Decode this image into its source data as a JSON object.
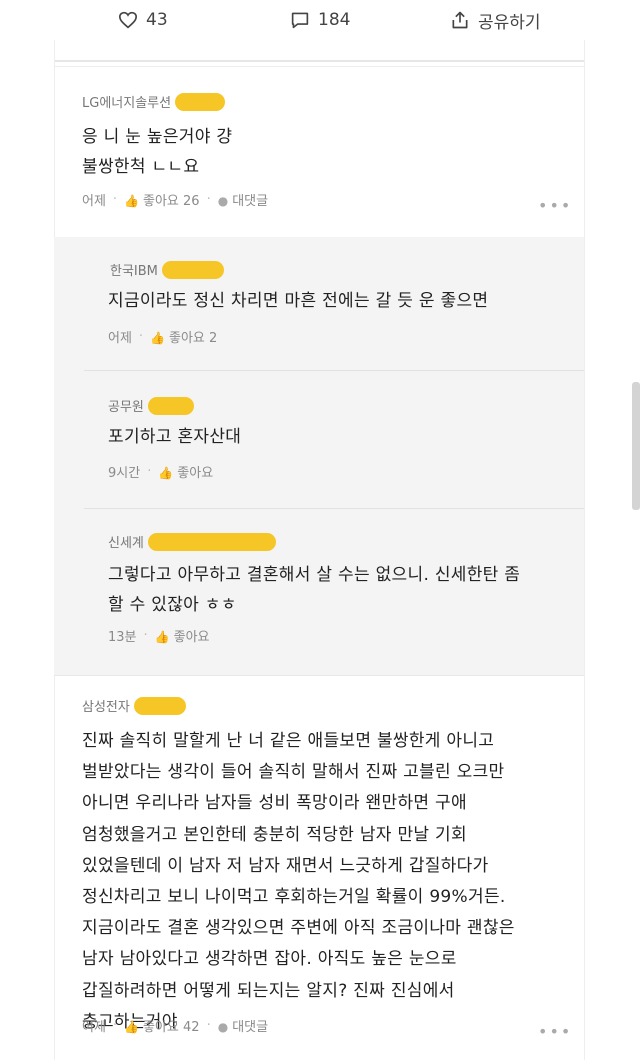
{
  "actions": {
    "likes": "43",
    "comments": "184",
    "share": "공유하기"
  },
  "comments": [
    {
      "company": "LG에너지솔루션",
      "text": "응 니 눈 높은거야 걍\n불쌍한척 ㄴㄴ요",
      "time": "어제",
      "like_label": "좋아요 26",
      "reply_label": "대댓글",
      "more": "•••"
    },
    {
      "company": "삼성전자",
      "text": "진짜 솔직히 말할게 난 너 같은 애들보면 불쌍한게 아니고\n벌받았다는 생각이 들어 솔직히 말해서 진짜 고블린 오크만\n아니면 우리나라 남자들 성비 폭망이라 왠만하면 구애\n엄청했을거고 본인한테 충분히 적당한 남자 만날 기회\n있었을텐데 이 남자 저 남자 재면서 느긋하게 갑질하다가\n정신차리고 보니 나이먹고 후회하는거일 확률이 99%거든.\n지금이라도 결혼 생각있으면 주변에 아직 조금이나마 괜찮은\n남자 남아있다고 생각하면 잡아. 아직도 높은 눈으로\n갑질하려하면 어떻게 되는지는 알지? 진짜 진심에서\n충고하는거야",
      "time": "어제",
      "like_label": "좋아요 42",
      "reply_label": "대댓글",
      "more": "•••"
    }
  ],
  "replies": [
    {
      "company": "한국IBM",
      "text": "지금이라도 정신 차리면 마흔 전에는 갈 듯 운 좋으면",
      "time": "어제",
      "like_label": "좋아요 2"
    },
    {
      "company": "공무원",
      "text": "포기하고 혼자산대",
      "time": "9시간",
      "like_label": "좋아요"
    },
    {
      "company": "신세계",
      "text": "그렇다고 아무하고 결혼해서 살 수는 없으니. 신세한탄 좀\n할 수 있잖아 ㅎㅎ",
      "time": "13분",
      "like_label": "좋아요"
    }
  ],
  "colors": {
    "redaction": "#f5c31a",
    "reply_background": "#f4f4f4"
  }
}
